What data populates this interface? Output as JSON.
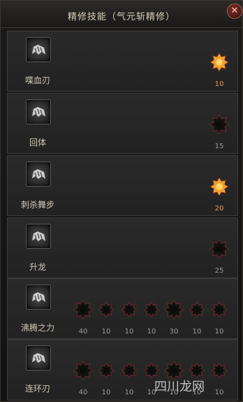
{
  "window": {
    "title": "精修技能（气元斩精修）",
    "close_label": "✕"
  },
  "skills": [
    {
      "name": "喋血刃",
      "nodes": [
        {
          "level": "10",
          "active": true
        }
      ]
    },
    {
      "name": "回体",
      "nodes": [
        {
          "level": "15",
          "active": false
        }
      ]
    },
    {
      "name": "刺杀舞步",
      "nodes": [
        {
          "level": "20",
          "active": true
        }
      ]
    },
    {
      "name": "升龙",
      "nodes": [
        {
          "level": "25",
          "active": false
        }
      ]
    },
    {
      "name": "沸腾之力",
      "nodes": [
        {
          "level": "40"
        },
        {
          "level": "10"
        },
        {
          "level": "10"
        },
        {
          "level": "10"
        },
        {
          "level": "30"
        },
        {
          "level": "10"
        },
        {
          "level": "10"
        }
      ]
    },
    {
      "name": "连环刃",
      "nodes": [
        {
          "level": "40"
        },
        {
          "level": "10"
        },
        {
          "level": "10"
        },
        {
          "level": "10"
        },
        {
          "level": "10"
        },
        {
          "level": "10"
        },
        {
          "level": "10"
        }
      ]
    }
  ],
  "watermark": "四川龙网",
  "colors": {
    "active_star": "#f2a02f",
    "inactive_star": "#111111",
    "star_border": "#5d2a2a"
  }
}
